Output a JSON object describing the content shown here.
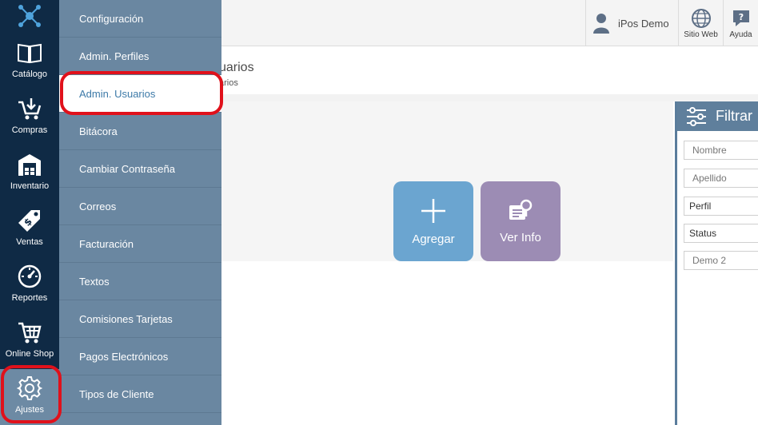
{
  "topbar": {
    "user_name": "iPos Demo",
    "website_label": "Sitio Web",
    "help_label": "Ayuda"
  },
  "page": {
    "title": "uarios",
    "breadcrumb": "arios"
  },
  "actions": {
    "add_label": "Agregar",
    "info_label": "Ver Info"
  },
  "filter": {
    "title": "Filtrar",
    "name_placeholder": "Nombre",
    "lastname_placeholder": "Apellido",
    "profile_value": "Perfil",
    "status_value": "Status",
    "company_placeholder": "Demo 2"
  },
  "sidebar": {
    "items": [
      {
        "label": "Catálogo",
        "icon": "book-icon"
      },
      {
        "label": "Compras",
        "icon": "cart-download-icon"
      },
      {
        "label": "Inventario",
        "icon": "warehouse-icon"
      },
      {
        "label": "Ventas",
        "icon": "price-tag-icon"
      },
      {
        "label": "Reportes",
        "icon": "gauge-icon"
      },
      {
        "label": "Online Shop",
        "icon": "shopping-cart-icon"
      },
      {
        "label": "Ajustes",
        "icon": "gear-icon"
      }
    ]
  },
  "menu": {
    "items": [
      "Configuración",
      "Admin. Perfiles",
      "Admin. Usuarios",
      "Bitácora",
      "Cambiar Contraseña",
      "Correos",
      "Facturación",
      "Textos",
      "Comisiones Tarjetas",
      "Pagos Electrónicos",
      "Tipos de Cliente"
    ],
    "active_index": 2
  },
  "colors": {
    "sidebar_bg": "#0f2a45",
    "flyout_bg": "#6a87a1",
    "active_text": "#3d7aa8",
    "add_button": "#6ba5d0",
    "info_button": "#9c8cb4",
    "highlight": "#e0111b"
  }
}
